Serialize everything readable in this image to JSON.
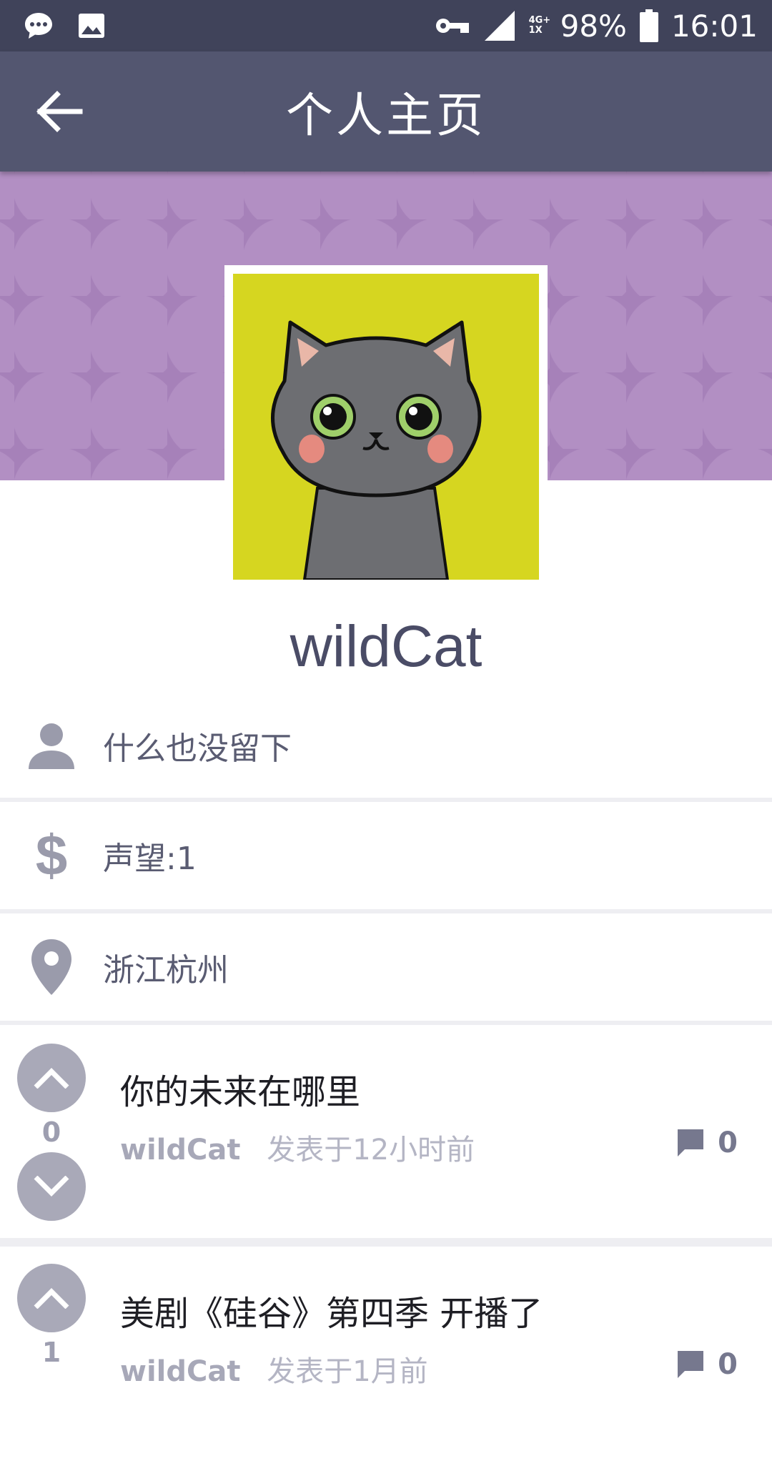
{
  "status_bar": {
    "battery": "98%",
    "time": "16:01",
    "network": "4G+ 1X",
    "icons": [
      "message-icon",
      "image-icon",
      "vpn-key-icon",
      "signal-icon",
      "battery-icon"
    ]
  },
  "toolbar": {
    "title": "个人主页",
    "back_icon": "arrow-back-icon"
  },
  "profile": {
    "username": "wildCat",
    "bio": "什么也没留下",
    "reputation": "声望:1",
    "location": "浙江杭州"
  },
  "posts": [
    {
      "title": "你的未来在哪里",
      "author": "wildCat",
      "time": "发表于12小时前",
      "votes": "0",
      "comments": "0"
    },
    {
      "title": "美剧《硅谷》第四季 开播了",
      "author": "wildCat",
      "time": "发表于1月前",
      "votes": "1",
      "comments": "0"
    }
  ],
  "colors": {
    "status_bar": "#40435a",
    "toolbar": "#535670",
    "banner": "#a681b9",
    "avatar_bg": "#d6d620",
    "icon_gray": "#9a9bab"
  }
}
